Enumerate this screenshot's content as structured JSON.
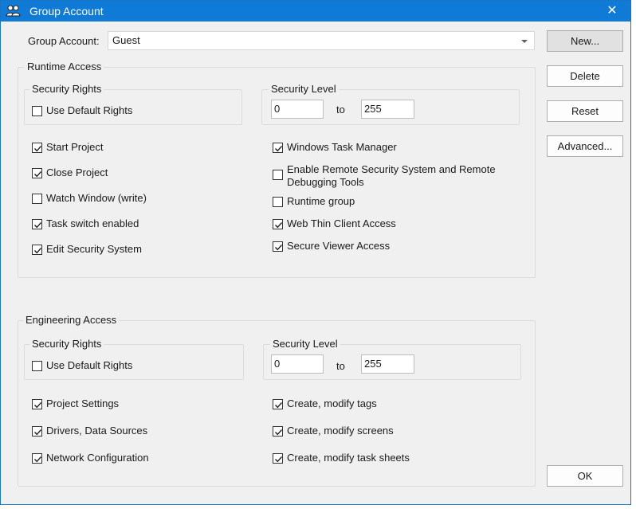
{
  "window": {
    "title": "Group Account",
    "close_glyph": "✕",
    "title_icon": "users-icon",
    "accent_color": "#0f7bd6"
  },
  "account": {
    "label": "Group Account:",
    "value": "Guest"
  },
  "buttons": {
    "new": "New...",
    "delete": "Delete",
    "reset": "Reset",
    "advanced": "Advanced...",
    "ok": "OK"
  },
  "runtime": {
    "title": "Runtime Access",
    "security_rights": {
      "title": "Security Rights",
      "use_default": {
        "label": "Use Default Rights",
        "checked": false
      }
    },
    "security_level": {
      "title": "Security Level",
      "from": "0",
      "to_label": "to",
      "to": "255"
    },
    "left_options": [
      {
        "label": "Start Project",
        "checked": true
      },
      {
        "label": "Close Project",
        "checked": true
      },
      {
        "label": "Watch Window (write)",
        "checked": false
      },
      {
        "label": "Task switch enabled",
        "checked": true
      },
      {
        "label": "Edit Security System",
        "checked": true
      }
    ],
    "right_options": [
      {
        "label": "Windows Task Manager",
        "checked": true
      },
      {
        "label": "Enable Remote Security System and Remote Debugging Tools",
        "checked": false
      },
      {
        "label": "Runtime group",
        "checked": false
      },
      {
        "label": "Web Thin Client Access",
        "checked": true
      },
      {
        "label": "Secure Viewer Access",
        "checked": true
      }
    ]
  },
  "engineering": {
    "title": "Engineering Access",
    "security_rights": {
      "title": "Security Rights",
      "use_default": {
        "label": "Use Default Rights",
        "checked": false
      }
    },
    "security_level": {
      "title": "Security Level",
      "from": "0",
      "to_label": "to",
      "to": "255"
    },
    "left_options": [
      {
        "label": "Project Settings",
        "checked": true
      },
      {
        "label": "Drivers, Data Sources",
        "checked": true
      },
      {
        "label": "Network Configuration",
        "checked": true
      }
    ],
    "right_options": [
      {
        "label": "Create, modify tags",
        "checked": true
      },
      {
        "label": "Create, modify screens",
        "checked": true
      },
      {
        "label": "Create, modify task sheets",
        "checked": true
      }
    ]
  }
}
